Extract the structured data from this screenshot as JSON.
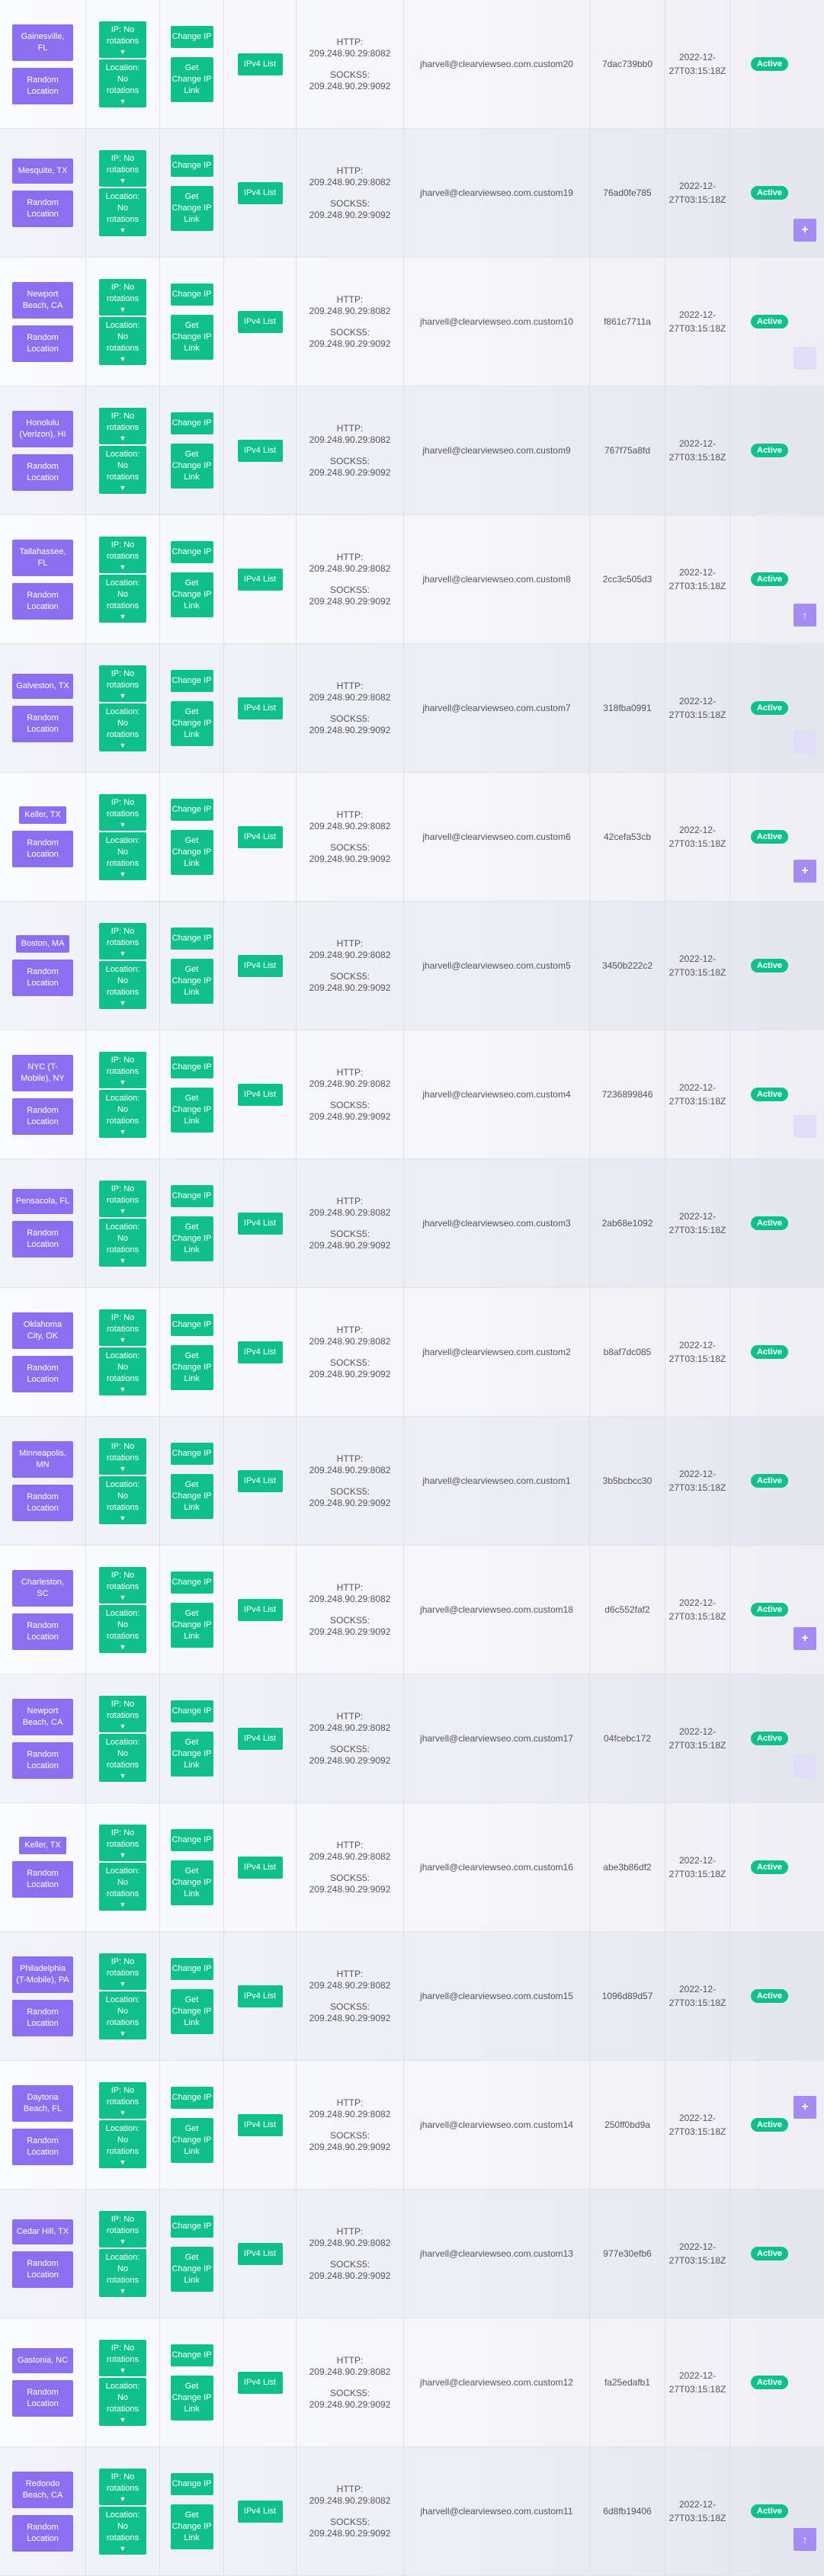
{
  "labels": {
    "ip_rotation": "IP: No rotations",
    "location_rotation": "Location: No rotations",
    "random_location": "Random Location",
    "change_ip": "Change IP",
    "get_change_ip_link": "Get Change IP Link",
    "ipv4_list": "IPv4 List",
    "http_prefix": "HTTP:",
    "socks_prefix": "SOCKS5:"
  },
  "icons": {
    "caret": "caret-down-icon",
    "add": "plus-icon",
    "up": "arrow-up-icon"
  },
  "colors": {
    "purple": "#8b6ff0",
    "green": "#10c08b"
  },
  "rows": [
    {
      "location": "Gainesville, FL",
      "http": "209.248.90.29:8082",
      "socks": "209.248.90.29:9092",
      "username": "jharvell@clearviewseo.com.custom20",
      "password": "7dac739bb0",
      "date1": "2022-12-",
      "date2": "27T03:15:18Z",
      "status": "Active"
    },
    {
      "location": "Mesquite, TX",
      "http": "209.248.90.29:8082",
      "socks": "209.248.90.29:9092",
      "username": "jharvell@clearviewseo.com.custom19",
      "password": "76ad0fe785",
      "date1": "2022-12-",
      "date2": "27T03:15:18Z",
      "status": "Active"
    },
    {
      "location": "Newport Beach, CA",
      "http": "209.248.90.29:8082",
      "socks": "209.248.90.29:9092",
      "username": "jharvell@clearviewseo.com.custom10",
      "password": "f861c7711a",
      "date1": "2022-12-",
      "date2": "27T03:15:18Z",
      "status": "Active"
    },
    {
      "location": "Honolulu (Verizon), HI",
      "http": "209.248.90.29:8082",
      "socks": "209.248.90.29:9092",
      "username": "jharvell@clearviewseo.com.custom9",
      "password": "767f75a8fd",
      "date1": "2022-12-",
      "date2": "27T03:15:18Z",
      "status": "Active"
    },
    {
      "location": "Tallahassee, FL",
      "http": "209.248.90.29:8082",
      "socks": "209.248.90.29:9092",
      "username": "jharvell@clearviewseo.com.custom8",
      "password": "2cc3c505d3",
      "date1": "2022-12-",
      "date2": "27T03:15:18Z",
      "status": "Active"
    },
    {
      "location": "Galveston, TX",
      "http": "209.248.90.29:8082",
      "socks": "209.248.90.29:9092",
      "username": "jharvell@clearviewseo.com.custom7",
      "password": "318fba0991",
      "date1": "2022-12-",
      "date2": "27T03:15:18Z",
      "status": "Active"
    },
    {
      "location": "Keller, TX",
      "http": "209.248.90.29:8082",
      "socks": "209.248.90.29:9092",
      "username": "jharvell@clearviewseo.com.custom6",
      "password": "42cefa53cb",
      "date1": "2022-12-",
      "date2": "27T03:15:18Z",
      "status": "Active"
    },
    {
      "location": "Boston, MA",
      "http": "209.248.90.29:8082",
      "socks": "209.248.90.29:9092",
      "username": "jharvell@clearviewseo.com.custom5",
      "password": "3450b222c2",
      "date1": "2022-12-",
      "date2": "27T03:15:18Z",
      "status": "Active"
    },
    {
      "location": "NYC (T-Mobile), NY",
      "http": "209.248.90.29:8082",
      "socks": "209.248.90.29:9092",
      "username": "jharvell@clearviewseo.com.custom4",
      "password": "7236899846",
      "date1": "2022-12-",
      "date2": "27T03:15:18Z",
      "status": "Active"
    },
    {
      "location": "Pensacola, FL",
      "http": "209.248.90.29:8082",
      "socks": "209.248.90.29:9092",
      "username": "jharvell@clearviewseo.com.custom3",
      "password": "2ab68e1092",
      "date1": "2022-12-",
      "date2": "27T03:15:18Z",
      "status": "Active"
    },
    {
      "location": "Oklahoma City, OK",
      "http": "209.248.90.29:8082",
      "socks": "209.248.90.29:9092",
      "username": "jharvell@clearviewseo.com.custom2",
      "password": "b8af7dc085",
      "date1": "2022-12-",
      "date2": "27T03:15:18Z",
      "status": "Active"
    },
    {
      "location": "Minneapolis, MN",
      "http": "209.248.90.29:8082",
      "socks": "209.248.90.29:9092",
      "username": "jharvell@clearviewseo.com.custom1",
      "password": "3b5bcbcc30",
      "date1": "2022-12-",
      "date2": "27T03:15:18Z",
      "status": "Active"
    },
    {
      "location": "Charleston, SC",
      "http": "209.248.90.29:8082",
      "socks": "209.248.90.29:9092",
      "username": "jharvell@clearviewseo.com.custom18",
      "password": "d6c552faf2",
      "date1": "2022-12-",
      "date2": "27T03:15:18Z",
      "status": "Active"
    },
    {
      "location": "Newport Beach, CA",
      "http": "209.248.90.29:8082",
      "socks": "209.248.90.29:9092",
      "username": "jharvell@clearviewseo.com.custom17",
      "password": "04fcebc172",
      "date1": "2022-12-",
      "date2": "27T03:15:18Z",
      "status": "Active"
    },
    {
      "location": "Keller, TX",
      "http": "209.248.90.29:8082",
      "socks": "209.248.90.29:9092",
      "username": "jharvell@clearviewseo.com.custom16",
      "password": "abe3b86df2",
      "date1": "2022-12-",
      "date2": "27T03:15:18Z",
      "status": "Active"
    },
    {
      "location": "Philadelphia (T-Mobile), PA",
      "http": "209.248.90.29:8082",
      "socks": "209.248.90.29:9092",
      "username": "jharvell@clearviewseo.com.custom15",
      "password": "1096d89d57",
      "date1": "2022-12-",
      "date2": "27T03:15:18Z",
      "status": "Active"
    },
    {
      "location": "Daytona Beach, FL",
      "http": "209.248.90.29:8082",
      "socks": "209.248.90.29:9092",
      "username": "jharvell@clearviewseo.com.custom14",
      "password": "250ff0bd9a",
      "date1": "2022-12-",
      "date2": "27T03:15:18Z",
      "status": "Active"
    },
    {
      "location": "Cedar Hill, TX",
      "http": "209.248.90.29:8082",
      "socks": "209.248.90.29:9092",
      "username": "jharvell@clearviewseo.com.custom13",
      "password": "977e30efb6",
      "date1": "2022-12-",
      "date2": "27T03:15:18Z",
      "status": "Active"
    },
    {
      "location": "Gastonia, NC",
      "http": "209.248.90.29:8082",
      "socks": "209.248.90.29:9092",
      "username": "jharvell@clearviewseo.com.custom12",
      "password": "fa25edafb1",
      "date1": "2022-12-",
      "date2": "27T03:15:18Z",
      "status": "Active"
    },
    {
      "location": "Redondo Beach, CA",
      "http": "209.248.90.29:8082",
      "socks": "209.248.90.29:9092",
      "username": "jharvell@clearviewseo.com.custom11",
      "password": "6d8fb19406",
      "date1": "2022-12-",
      "date2": "27T03:15:18Z",
      "status": "Active"
    }
  ],
  "floating_buttons": [
    {
      "kind": "add",
      "label": "+"
    },
    {
      "kind": "faint",
      "label": ""
    },
    {
      "kind": "up",
      "label": "↑"
    },
    {
      "kind": "faint",
      "label": ""
    },
    {
      "kind": "add",
      "label": "+"
    },
    {
      "kind": "faint",
      "label": ""
    },
    {
      "kind": "add",
      "label": "+"
    },
    {
      "kind": "faint",
      "label": ""
    },
    {
      "kind": "add",
      "label": "+"
    },
    {
      "kind": "up",
      "label": "↑"
    }
  ]
}
